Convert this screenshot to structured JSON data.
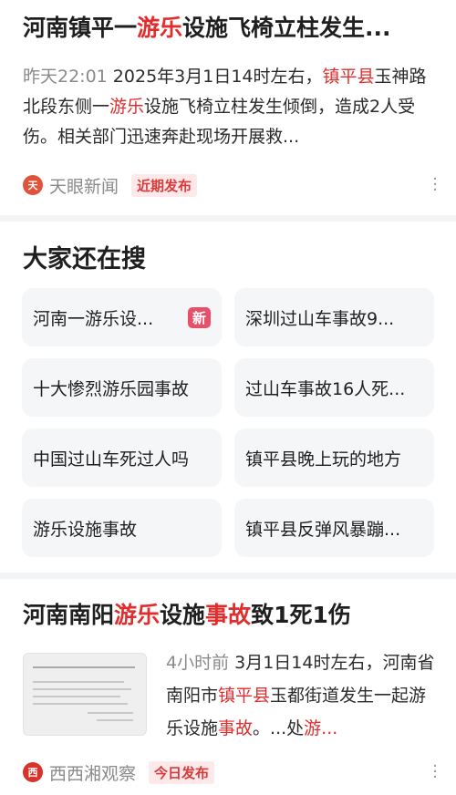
{
  "card1": {
    "title_pre": "河南镇平一",
    "title_hl": "游乐",
    "title_post": "设施飞椅立柱发生...",
    "time": "昨天22:01",
    "snippet_a": "  2025年3月1日14时左右，",
    "snippet_hl1": "镇平县",
    "snippet_b": "玉神路北段东侧一",
    "snippet_hl2": "游乐",
    "snippet_c": "设施飞椅立柱发生倾倒，造成2人受伤。相关部门迅速奔赴现场开展救...",
    "source": "天眼新闻",
    "tag": "近期发布",
    "logo_text": "天",
    "logo_color": "#e0533b"
  },
  "related": {
    "title": "大家还在搜",
    "items": [
      {
        "label": "河南一游乐设...",
        "badge": "新"
      },
      {
        "label": "深圳过山车事故9..."
      },
      {
        "label": "十大惨烈游乐园事故"
      },
      {
        "label": "过山车事故16人死..."
      },
      {
        "label": "中国过山车死过人吗"
      },
      {
        "label": "镇平县晚上玩的地方"
      },
      {
        "label": "游乐设施事故"
      },
      {
        "label": "镇平县反弹风暴蹦..."
      }
    ]
  },
  "card3": {
    "title_pre": "河南南阳",
    "title_hl1": "游乐",
    "title_mid": "设施",
    "title_hl2": "事故",
    "title_post": "致1死1伤",
    "time": "4小时前",
    "snippet_a": "  3月1日14时左右，河南省南阳市",
    "snippet_hl1": "镇平县",
    "snippet_b": "玉都街道发生一起游乐设施",
    "snippet_hl2": "事故",
    "snippet_c": "。...处",
    "snippet_hl3": "游...",
    "source": "西西湘观察",
    "tag": "今日发布",
    "logo_text": "西",
    "logo_color": "#d8332b"
  }
}
